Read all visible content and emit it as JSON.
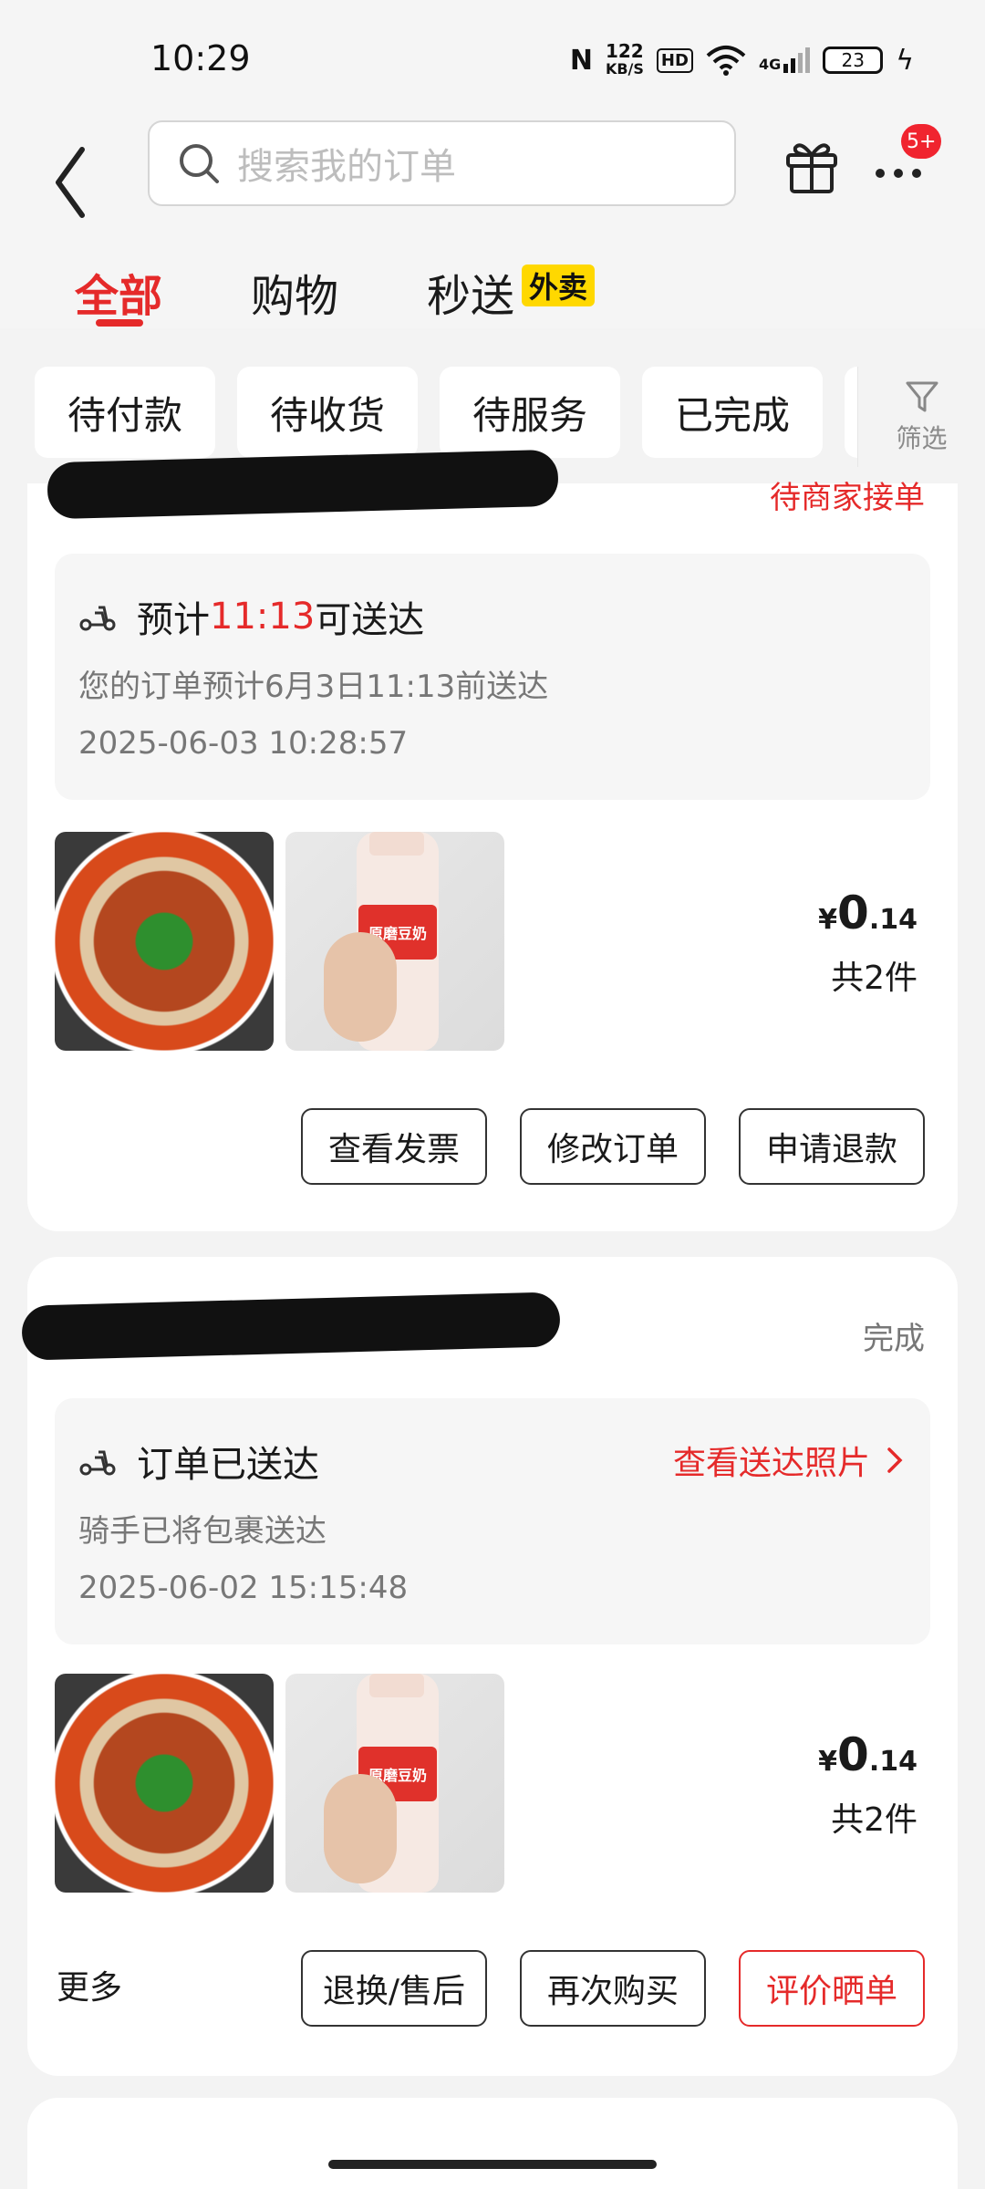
{
  "status_bar": {
    "time": "10:29",
    "net_speed_value": "122",
    "net_speed_unit": "KB/S",
    "hd": "HD",
    "network": "4G",
    "battery": "23"
  },
  "header": {
    "search_placeholder": "搜索我的订单",
    "notification_badge": "5+"
  },
  "tabs": {
    "all": "全部",
    "shopping": "购物",
    "express": "秒送",
    "express_badge": "外卖"
  },
  "filters": {
    "pending_payment": "待付款",
    "pending_receipt": "待收货",
    "pending_service": "待服务",
    "completed": "已完成",
    "filter_label": "筛选"
  },
  "orders": [
    {
      "status": "待商家接单",
      "info_prefix": "预计",
      "info_time": "11:13",
      "info_suffix": "可送达",
      "info_sub": "您的订单预计6月3日11:13前送达",
      "timestamp": "2025-06-03 10:28:57",
      "thumb_label": "原磨豆奶",
      "price_yen": "¥",
      "price_int": "0",
      "price_dec": ".14",
      "count": "共2件",
      "buttons": [
        "查看发票",
        "修改订单",
        "申请退款"
      ]
    },
    {
      "status": "完成",
      "info_title": "订单已送达",
      "photo_link": "查看送达照片",
      "info_sub": "骑手已将包裹送达",
      "timestamp": "2025-06-02 15:15:48",
      "thumb_label": "原磨豆奶",
      "price_yen": "¥",
      "price_int": "0",
      "price_dec": ".14",
      "count": "共2件",
      "more": "更多",
      "buttons": [
        "退换/售后",
        "再次购买",
        "评价晒单"
      ]
    }
  ],
  "colors": {
    "accent_red": "#e52a2a",
    "badge_yellow": "#ffd800",
    "page_bg": "#f3f3f3"
  }
}
